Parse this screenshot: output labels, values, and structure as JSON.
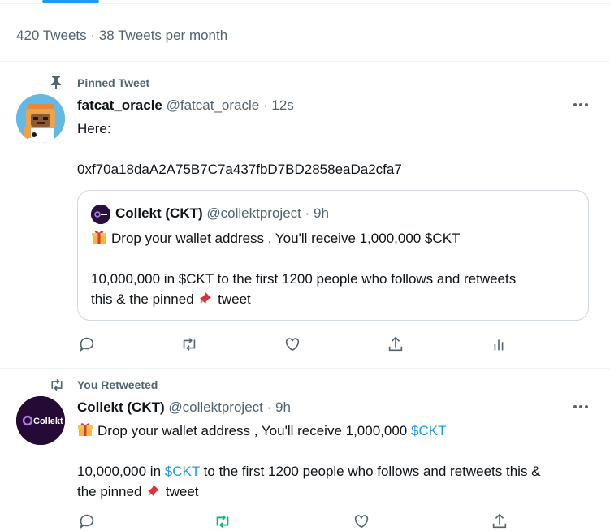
{
  "profile": {
    "stats_text": "420 Tweets · 38 Tweets per month"
  },
  "pinned_tweet": {
    "context_label": "Pinned Tweet",
    "author_name": "fatcat_oracle",
    "author_handle": "@fatcat_oracle",
    "separator": "·",
    "time": "12s",
    "line1": "Here:",
    "line2": "0xf70a18daA2A75B7C7a437fbD7BD2858eaDa2cfa7",
    "quoted": {
      "author_name": "Collekt (CKT)",
      "author_handle": "@collektproject",
      "time": "9h",
      "line1": "Drop your wallet address , You'll receive 1,000,000 $CKT",
      "line2": "10,000,000 in $CKT to the first 1200 people who follows and retweets",
      "line3_a": "this & the pinned",
      "line3_b": "tweet",
      "avatar_label": "Collekt"
    }
  },
  "retweet": {
    "context_label": "You Retweeted",
    "author_name": "Collekt (CKT)",
    "author_handle": "@collektproject",
    "separator": "·",
    "time": "9h",
    "line1_a": "Drop your wallet address , You'll receive 1,000,000",
    "line1_link": "$CKT",
    "line2_a": "10,000,000 in",
    "line2_link": "$CKT",
    "line2_b": "to the first 1200 people who follows and retweets this &",
    "line3_a": "the pinned",
    "line3_b": "tweet",
    "avatar_label": "Collekt"
  },
  "colors": {
    "accent": "#1d9bf0",
    "muted": "#536471",
    "retweet_green": "#00ba7c"
  }
}
